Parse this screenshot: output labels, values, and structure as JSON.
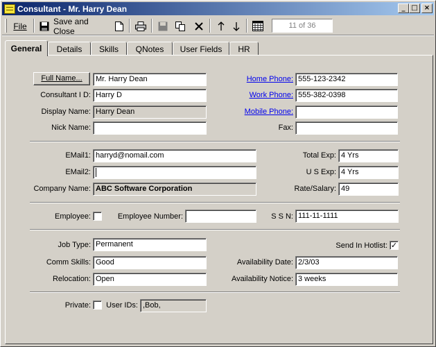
{
  "window": {
    "title": "Consultant - Mr. Harry Dean",
    "minimize": "_",
    "maximize": "□",
    "close": "×"
  },
  "toolbar": {
    "file_label": "File",
    "save_close_label": "Save and Close",
    "record_counter": "11 of 36"
  },
  "tabs": [
    "General",
    "Details",
    "Skills",
    "QNotes",
    "User Fields",
    "HR"
  ],
  "active_tab": "General",
  "form": {
    "full_name_button": "Full Name...",
    "full_name": "Mr. Harry Dean",
    "consultant_id_label": "Consultant I D:",
    "consultant_id": "Harry D",
    "display_name_label": "Display Name:",
    "display_name": "Harry Dean",
    "nick_name_label": "Nick Name:",
    "nick_name": "",
    "home_phone_label": "Home Phone:",
    "home_phone": "555-123-2342",
    "work_phone_label": "Work Phone:",
    "work_phone": "555-382-0398",
    "mobile_phone_label": "Mobile Phone:",
    "mobile_phone": "",
    "fax_label": "Fax:",
    "fax": "",
    "email1_label": "EMail1:",
    "email1": "harryd@nomail.com",
    "email2_label": "EMail2:",
    "email2": "",
    "company_name_label": "Company Name:",
    "company_name": "ABC Software Corporation",
    "total_exp_label": "Total Exp:",
    "total_exp": "4 Yrs",
    "us_exp_label": "U S Exp:",
    "us_exp": "4 Yrs",
    "rate_salary_label": "Rate/Salary:",
    "rate_salary": "49",
    "employee_label": "Employee:",
    "employee_checked": "",
    "employee_number_label": "Employee Number:",
    "employee_number": "",
    "ssn_label": "S S N:",
    "ssn": "111-11-1111",
    "job_type_label": "Job Type:",
    "job_type": "Permanent",
    "send_in_hotlist_label": "Send In Hotlist:",
    "send_in_hotlist_checked": "✓",
    "comm_skills_label": "Comm Skills:",
    "comm_skills": "Good",
    "availability_date_label": "Availability Date:",
    "availability_date": "2/3/03",
    "relocation_label": "Relocation:",
    "relocation": "Open",
    "availability_notice_label": "Availability Notice:",
    "availability_notice": "3 weeks",
    "private_label": "Private:",
    "private_checked": "",
    "user_ids_label": "User IDs:",
    "user_ids": ",Bob,"
  }
}
